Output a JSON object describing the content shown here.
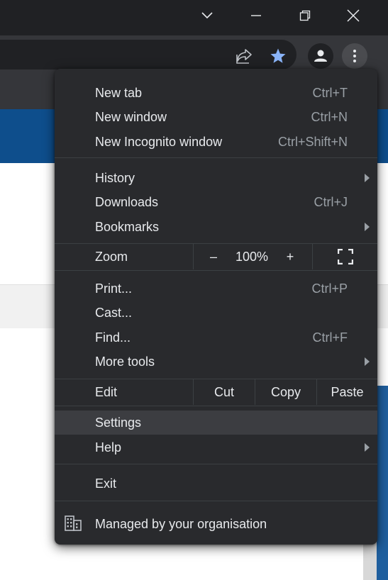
{
  "menu": {
    "new_tab": {
      "label": "New tab",
      "shortcut": "Ctrl+T"
    },
    "new_window": {
      "label": "New window",
      "shortcut": "Ctrl+N"
    },
    "new_incognito": {
      "label": "New Incognito window",
      "shortcut": "Ctrl+Shift+N"
    },
    "history": {
      "label": "History"
    },
    "downloads": {
      "label": "Downloads",
      "shortcut": "Ctrl+J"
    },
    "bookmarks": {
      "label": "Bookmarks"
    },
    "zoom": {
      "label": "Zoom",
      "minus": "–",
      "level": "100%",
      "plus": "+"
    },
    "print": {
      "label": "Print...",
      "shortcut": "Ctrl+P"
    },
    "cast": {
      "label": "Cast..."
    },
    "find": {
      "label": "Find...",
      "shortcut": "Ctrl+F"
    },
    "more_tools": {
      "label": "More tools"
    },
    "edit": {
      "label": "Edit",
      "cut": "Cut",
      "copy": "Copy",
      "paste": "Paste"
    },
    "settings": {
      "label": "Settings"
    },
    "help": {
      "label": "Help"
    },
    "exit": {
      "label": "Exit"
    },
    "managed": {
      "label": "Managed by your organisation"
    }
  },
  "icons": {
    "tab_search": "chevron-down-icon",
    "minimize": "minimize-icon",
    "restore": "restore-icon",
    "close": "close-icon",
    "share": "share-icon",
    "bookmark": "star-icon",
    "profile": "profile-icon",
    "menu": "kebab-menu-icon",
    "fullscreen": "fullscreen-icon",
    "managed": "building-icon"
  },
  "colors": {
    "menu_bg": "#292a2d",
    "selected_bg": "#3c3d41",
    "star": "#8ab4f8",
    "text": "#e8eaed",
    "shortcut": "#9aa0a6"
  }
}
